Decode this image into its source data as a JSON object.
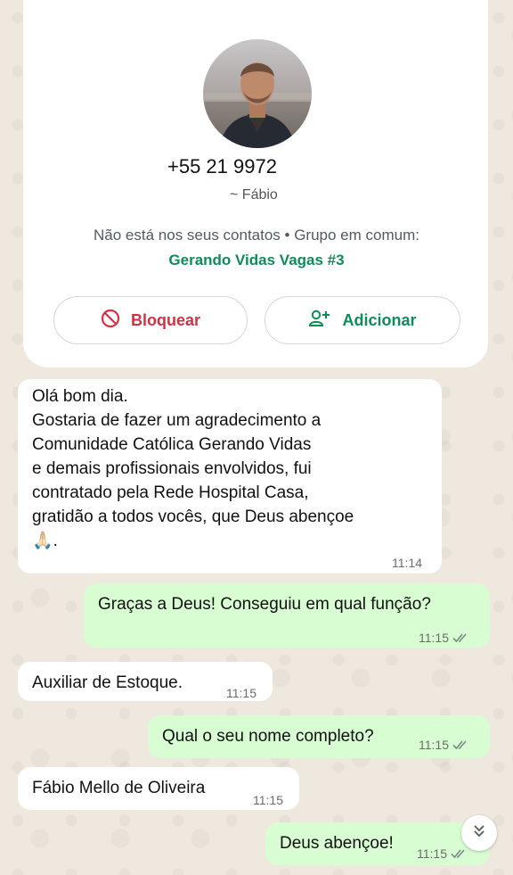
{
  "contact": {
    "phone": "+55 21 9972",
    "push_name": "~ Fábio",
    "not_in_contacts": "Não está nos seus contatos • Grupo em comum:",
    "common_group": "Gerando Vidas Vagas #3",
    "block_label": "Bloquear",
    "add_label": "Adicionar"
  },
  "colors": {
    "accent_green": "#118a5a",
    "block_red": "#d23145",
    "outgoing_bubble": "#d8fdd2",
    "incoming_bubble": "#ffffff",
    "wallpaper": "#efe8df"
  },
  "messages": [
    {
      "direction": "in",
      "lines": [
        "Olá bom dia.",
        "Gostaria de fazer um agradecimento a",
        "Comunidade Católica Gerando Vidas",
        "e demais profissionais envolvidos, fui",
        "contratado pela Rede Hospital Casa,",
        "gratidão a todos vocês, que Deus abençoe"
      ],
      "emoji": "🙏🏻",
      "emoji_suffix": ".",
      "time": "11:14"
    },
    {
      "direction": "out",
      "text": "Graças a Deus! Conseguiu em qual função?",
      "time": "11:15",
      "status": "read"
    },
    {
      "direction": "in",
      "text": "Auxiliar de Estoque.",
      "time": "11:15"
    },
    {
      "direction": "out",
      "text": "Qual o seu nome completo?",
      "time": "11:15",
      "status": "read"
    },
    {
      "direction": "in",
      "text": "Fábio Mello de Oliveira",
      "time": "11:15"
    },
    {
      "direction": "out",
      "text": "Deus abençoe!",
      "time": "11:15",
      "status": "read"
    }
  ],
  "icons": {
    "block": "block-icon",
    "add_contact": "add-contact-icon",
    "read_receipt": "double-check-icon",
    "scroll_down": "double-chevron-down-icon"
  }
}
